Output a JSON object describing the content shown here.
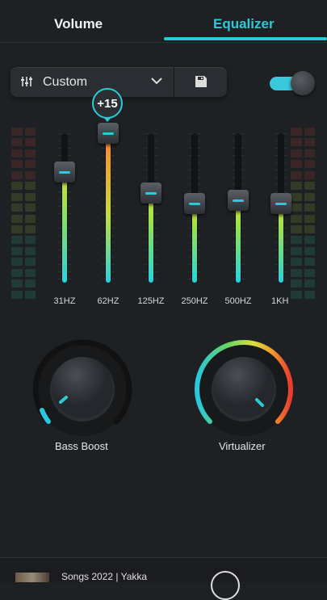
{
  "tabs": {
    "volume": "Volume",
    "equalizer": "Equalizer"
  },
  "preset": {
    "label": "Custom",
    "icons": [
      "sliders-icon",
      "chevron-down-icon",
      "save-icon"
    ]
  },
  "toggle": {
    "on": true,
    "color": "#39c9dc"
  },
  "colors": {
    "accent": "#2ec9d6",
    "background": "#1e2124"
  },
  "bands": [
    {
      "label": "31HZ",
      "level": 0.74
    },
    {
      "label": "62HZ",
      "level": 1.0
    },
    {
      "label": "125HZ",
      "level": 0.6
    },
    {
      "label": "250HZ",
      "level": 0.53
    },
    {
      "label": "500HZ",
      "level": 0.55
    },
    {
      "label": "1KH",
      "level": 0.53
    }
  ],
  "active_band_value": "+15",
  "knobs": {
    "bass_boost": {
      "label": "Bass Boost",
      "level": 0.05
    },
    "virtualizer": {
      "label": "Virtualizer",
      "level": 0.95
    }
  },
  "player": {
    "song": "Songs 2022 | Yakka"
  }
}
